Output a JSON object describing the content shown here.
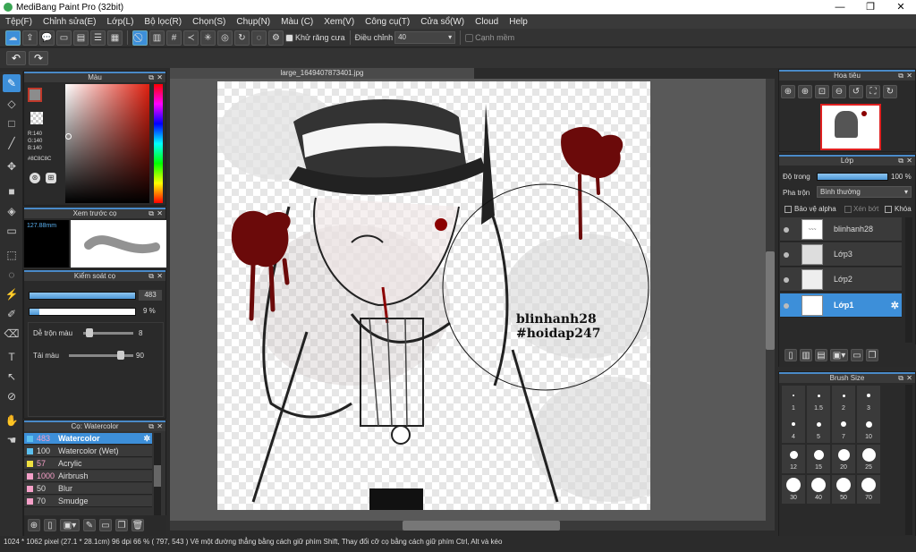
{
  "app": {
    "title": "MediBang Paint Pro (32bit)"
  },
  "window_controls": {
    "minimize": "—",
    "maximize": "❐",
    "close": "✕"
  },
  "menu": [
    "Tệp(F)",
    "Chỉnh sửa(E)",
    "Lớp(L)",
    "Bộ lọc(R)",
    "Chọn(S)",
    "Chụp(N)",
    "Màu (C)",
    "Xem(V)",
    "Công cụ(T)",
    "Cửa sổ(W)",
    "Cloud",
    "Help"
  ],
  "toolbar": {
    "antialias_label": "Khử răng cưa",
    "adjust_label": "Điều chỉnh",
    "adjust_value": "40",
    "smooth_label": "Cạnh mềm"
  },
  "document": {
    "tab_title": "large_1649407873401.jpg"
  },
  "color_panel": {
    "title": "Màu",
    "r": "R:140",
    "g": "G:140",
    "b": "B:140",
    "hex": "#8C8C8C"
  },
  "brush_preview": {
    "title": "Xem trước cọ",
    "size": "127.88mm"
  },
  "brush_control": {
    "title": "Kiểm soát cọ",
    "size_value": "483",
    "opacity_value": "9 %",
    "blend_label": "Dễ trộn màu",
    "blend_value": "8",
    "amount_label": "Tải màu",
    "amount_value": "90"
  },
  "brush_list": {
    "title": "Cọ: Watercolor",
    "items": [
      {
        "num": "483",
        "name": "Watercolor",
        "color": "#5bc0f0",
        "selected": true
      },
      {
        "num": "100",
        "name": "Watercolor (Wet)",
        "color": "#5bc0f0",
        "selected": false
      },
      {
        "num": "57",
        "name": "Acrylic",
        "color": "#f0e040",
        "selected": false
      },
      {
        "num": "1000",
        "name": "Airbrush",
        "color": "#f5a0c8",
        "selected": false
      },
      {
        "num": "50",
        "name": "Blur",
        "color": "#f5a0c8",
        "selected": false
      },
      {
        "num": "70",
        "name": "Smudge",
        "color": "#f5a0c8",
        "selected": false
      }
    ]
  },
  "navigator": {
    "title": "Hoa tiêu"
  },
  "layer_panel": {
    "title": "Lớp",
    "opacity_label": "Độ trong",
    "opacity_value": "100 %",
    "opacity_fraction": 1.0,
    "blend_label": "Pha trộn",
    "blend_value": "Bình thường",
    "protect_alpha": "Bảo vệ alpha",
    "clip": "Xén bớt",
    "lock": "Khóa",
    "layers": [
      {
        "name": "blinhanh28",
        "selected": false
      },
      {
        "name": "Lớp3",
        "selected": false
      },
      {
        "name": "Lớp2",
        "selected": false
      },
      {
        "name": "Lớp1",
        "selected": true
      }
    ]
  },
  "brush_size": {
    "title": "Brush Size",
    "sizes": [
      "1",
      "1.5",
      "2",
      "3",
      "4",
      "5",
      "7",
      "10",
      "12",
      "15",
      "20",
      "25",
      "30",
      "40",
      "50",
      "70"
    ]
  },
  "canvas_text": {
    "line1": "blinhanh28",
    "line2": "#hoidap247"
  },
  "status": {
    "text": "1024 * 1062 pixel   (27.1 * 28.1cm)   96 dpi   66 %   ( 797, 543 )   Vẽ một đường thẳng bằng cách giữ phím Shift, Thay đổi cỡ cọ bằng cách giữ phím Ctrl, Alt và kéo"
  }
}
